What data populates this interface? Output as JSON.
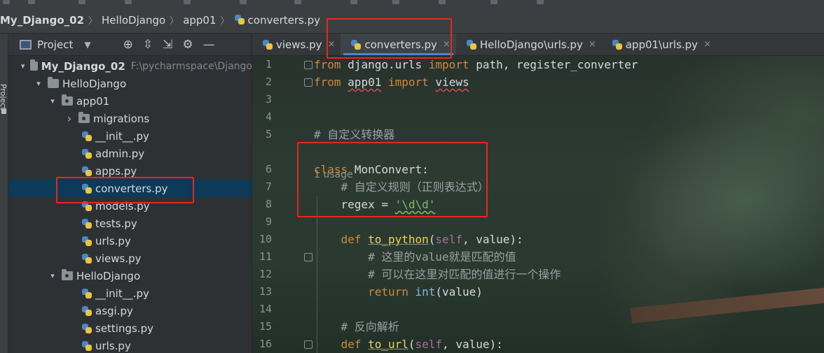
{
  "breadcrumb": {
    "project": "My_Django_02",
    "folder1": "HelloDjango",
    "folder2": "app01",
    "file": "converters.py"
  },
  "tool_strip": {
    "label": "Project"
  },
  "project_panel": {
    "title": "Project",
    "tree": [
      {
        "label": "My_Django_02",
        "path": "F:\\pycharmspace\\Django",
        "bold": true,
        "type": "folder",
        "expanded": true,
        "depth": 0
      },
      {
        "label": "HelloDjango",
        "type": "folder",
        "expanded": true,
        "depth": 1
      },
      {
        "label": "app01",
        "type": "package",
        "expanded": true,
        "depth": 2
      },
      {
        "label": "migrations",
        "type": "package",
        "expanded": false,
        "depth": 3
      },
      {
        "label": "__init__.py",
        "type": "file",
        "depth": 4
      },
      {
        "label": "admin.py",
        "type": "file",
        "depth": 4
      },
      {
        "label": "apps.py",
        "type": "file",
        "depth": 4
      },
      {
        "label": "converters.py",
        "type": "file",
        "depth": 4,
        "selected": true
      },
      {
        "label": "models.py",
        "type": "file",
        "depth": 4
      },
      {
        "label": "tests.py",
        "type": "file",
        "depth": 4
      },
      {
        "label": "urls.py",
        "type": "file",
        "depth": 4
      },
      {
        "label": "views.py",
        "type": "file",
        "depth": 4
      },
      {
        "label": "HelloDjango",
        "type": "package",
        "expanded": true,
        "depth": 2
      },
      {
        "label": "__init__.py",
        "type": "file",
        "depth": 4
      },
      {
        "label": "asgi.py",
        "type": "file",
        "depth": 4
      },
      {
        "label": "settings.py",
        "type": "file",
        "depth": 4
      },
      {
        "label": "urls.py",
        "type": "file",
        "depth": 4
      }
    ]
  },
  "tabs": [
    {
      "label": "views.py",
      "active": false
    },
    {
      "label": "converters.py",
      "active": true
    },
    {
      "label": "HelloDjango\\urls.py",
      "active": false
    },
    {
      "label": "app01\\urls.py",
      "active": false
    }
  ],
  "editor": {
    "usage_hint": "1 usage",
    "lines": [
      {
        "n": "1",
        "t": "from django.urls import path, register_converter"
      },
      {
        "n": "2",
        "t": "from app01 import views"
      },
      {
        "n": "3",
        "t": ""
      },
      {
        "n": "4",
        "t": ""
      },
      {
        "n": "5",
        "t": "# 自定义转换器"
      },
      {
        "n": "6",
        "t": "class MonConvert:"
      },
      {
        "n": "7",
        "t": "    # 自定义规则（正则表达式）"
      },
      {
        "n": "8",
        "t": "    regex = '\\d\\d'"
      },
      {
        "n": "9",
        "t": ""
      },
      {
        "n": "10",
        "t": "    def to_python(self, value):"
      },
      {
        "n": "11",
        "t": "        # 这里的value就是匹配的值"
      },
      {
        "n": "12",
        "t": "        # 可以在这里对匹配的值进行一个操作"
      },
      {
        "n": "13",
        "t": "        return int(value)"
      },
      {
        "n": "14",
        "t": ""
      },
      {
        "n": "15",
        "t": "    # 反向解析"
      },
      {
        "n": "16",
        "t": "    def to_url(self, value):"
      }
    ]
  },
  "colors": {
    "keyword": "#d08a3a",
    "comment": "#9aa0a5",
    "function": "#f0d35c",
    "string": "#7fb768",
    "annotation": "#e6281f",
    "selection": "#0d3a58"
  }
}
